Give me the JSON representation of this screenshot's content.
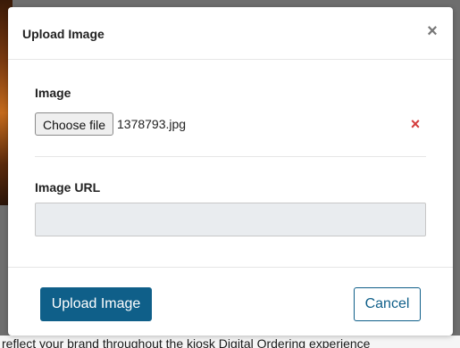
{
  "background": {
    "partial_text": "reflect your brand throughout the kiosk Digital Ordering experience"
  },
  "modal": {
    "title": "Upload Image",
    "close_symbol": "×",
    "image_field": {
      "label": "Image",
      "choose_button_label": "Choose file",
      "selected_file_name": "1378793.jpg",
      "remove_symbol": "×"
    },
    "url_field": {
      "label": "Image URL",
      "value": ""
    },
    "footer": {
      "upload_button_label": "Upload Image",
      "cancel_button_label": "Cancel"
    }
  },
  "colors": {
    "primary": "#0f5f89",
    "remove_icon": "#d43c3c",
    "disabled_input_bg": "#e9ecef"
  },
  "icons": {
    "close": "close-icon",
    "remove_file": "remove-file-icon"
  }
}
